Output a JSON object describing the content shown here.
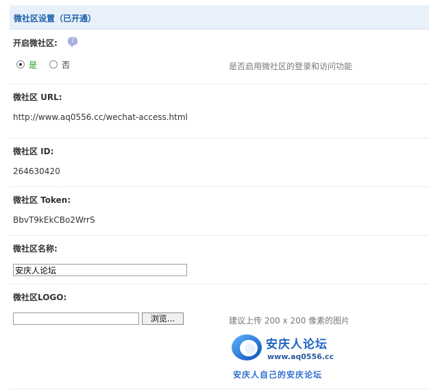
{
  "header": {
    "title": "微社区设置（已开通）"
  },
  "enable": {
    "label": "开启微社区:",
    "help_icon": "speech-bubble-icon",
    "options": [
      {
        "label": "是",
        "checked": true
      },
      {
        "label": "否",
        "checked": false
      }
    ],
    "hint": "是否启用微社区的登录和访问功能"
  },
  "url": {
    "label": "微社区 URL:",
    "value": "http://www.aq0556.cc/wechat-access.html"
  },
  "id": {
    "label": "微社区 ID:",
    "value": "264630420"
  },
  "token": {
    "label": "微社区 Token:",
    "value": "BbvT9kEkCBo2WrrS"
  },
  "name": {
    "label": "微社区名称:",
    "value": "安庆人论坛"
  },
  "logo": {
    "label": "微社区LOGO:",
    "browse_label": "浏览...",
    "hint": "建议上传 200 x 200 像素的图片",
    "brand_title": "安庆人论坛",
    "brand_url": "www.aq0556.cc",
    "brand_slogan": "安庆人自己的安庆论坛"
  },
  "colors": {
    "header_bg": "#e8f0fa",
    "header_text": "#1f5fa8",
    "yes_green": "#1a9a1a",
    "logo_blue": "#1d63c0"
  }
}
